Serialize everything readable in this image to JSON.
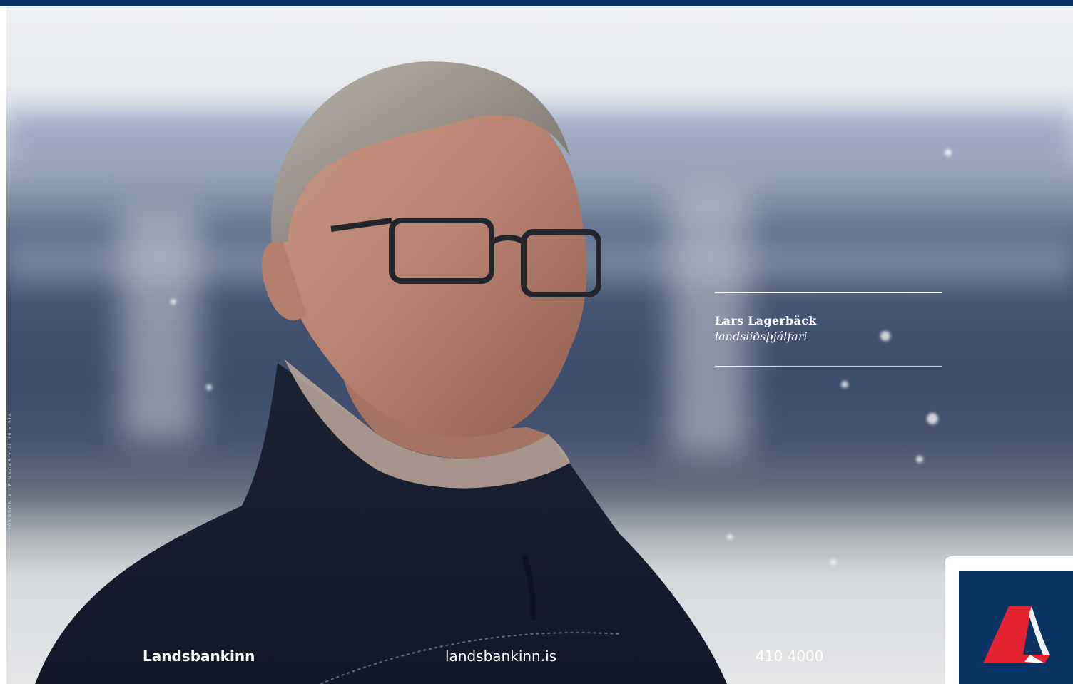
{
  "photo_credit": "JÓNSSON & LE'MACKS • JL.18 • SÍA",
  "caption": {
    "name": "Lars Lagerbäck",
    "role": "landsliðsþjálfari"
  },
  "footer": {
    "brand": "Landsbankinn",
    "url": "landsbankinn.is",
    "phone": "410 4000"
  },
  "logo": {
    "icon": "landsbankinn-logo-icon",
    "colors": {
      "navy": "#0b3464",
      "red": "#e3232f",
      "white": "#ffffff"
    }
  }
}
